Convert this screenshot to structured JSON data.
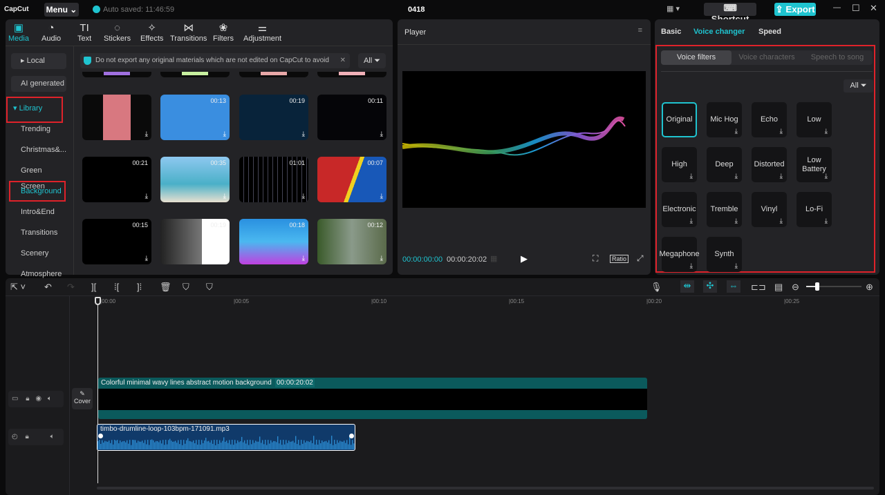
{
  "app": {
    "logo": "CapCut",
    "menu": "Menu",
    "autosave": "Auto saved: 11:46:59",
    "project": "0418",
    "shortcut": "Shortcut",
    "export": "Export",
    "accent": "#1fc4d0"
  },
  "tabs": [
    {
      "label": "Media",
      "icon": "media-icon"
    },
    {
      "label": "Audio",
      "icon": "audio-icon"
    },
    {
      "label": "Text",
      "icon": "TI"
    },
    {
      "label": "Stickers",
      "icon": "sticker-icon"
    },
    {
      "label": "Effects",
      "icon": "effects-icon"
    },
    {
      "label": "Transitions",
      "icon": "transition-icon"
    },
    {
      "label": "Filters",
      "icon": "filters-icon"
    },
    {
      "label": "Adjustment",
      "icon": "adjust-icon"
    }
  ],
  "sidebar": {
    "local": "Local",
    "ai": "AI generated",
    "library": "Library",
    "items": [
      "Trending",
      "Christmas&...",
      "Green Screen",
      "Background",
      "Intro&End",
      "Transitions",
      "Scenery",
      "Atmosphere"
    ]
  },
  "notice": {
    "text": "Do not export any original materials which are not edited on CapCut to avoid",
    "all": "All"
  },
  "thumbs": [
    "",
    "00:13",
    "00:19",
    "00:11",
    "00:21",
    "00:35",
    "01:01",
    "00:07",
    "00:15",
    "00:19",
    "00:18",
    "00:12"
  ],
  "player": {
    "title": "Player",
    "current": "00:00:00:00",
    "total": "00:00:20:02",
    "ratio": "Ratio"
  },
  "right": {
    "tabs": [
      "Basic",
      "Voice changer",
      "Speed"
    ],
    "subtabs": [
      "Voice filters",
      "Voice characters",
      "Speech to song"
    ],
    "all": "All",
    "filters": [
      "Original",
      "Mic Hog",
      "Echo",
      "Low",
      "High",
      "Deep",
      "Distorted",
      "Low Battery",
      "Electronic",
      "Tremble",
      "Vinyl",
      "Lo-Fi",
      "Megaphone",
      "Synth"
    ]
  },
  "timeline": {
    "ticks": [
      "00:00",
      "00:05",
      "00:10",
      "00:15",
      "00:20",
      "00:25"
    ],
    "cover": "Cover",
    "video_clip": "Colorful minimal wavy lines abstract motion background",
    "video_dur": "00:00:20:02",
    "audio_clip": "timbo-drumline-loop-103bpm-171091.mp3",
    "zoom_level": 0.2
  }
}
